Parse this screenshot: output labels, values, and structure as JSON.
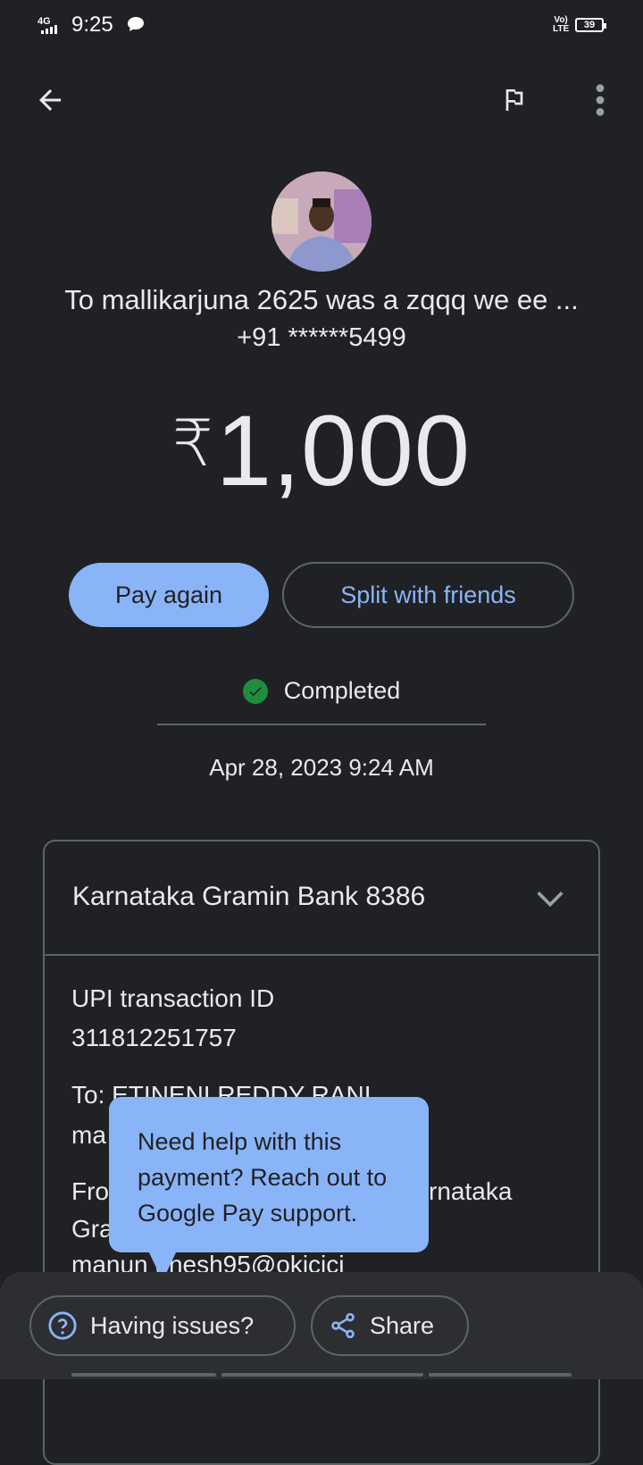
{
  "status_bar": {
    "network": "4G",
    "time": "9:25",
    "volte": "Vo)\nLTE",
    "battery": "39"
  },
  "top_bar": {
    "back_icon": "arrow-back-icon",
    "flag_icon": "flag-icon",
    "more_icon": "more-vert-icon"
  },
  "recipient": {
    "name": "To mallikarjuna 2625 was a zqqq we ee ...",
    "phone": "+91 ******5499"
  },
  "amount": {
    "currency": "₹",
    "value": "1,000"
  },
  "actions": {
    "pay_again": "Pay again",
    "split": "Split with friends"
  },
  "status": {
    "label": "Completed",
    "datetime": "Apr 28, 2023 9:24 AM",
    "color": "#1e8e3e"
  },
  "details": {
    "bank": "Karnataka Gramin Bank 8386",
    "txn_label": "UPI transaction ID",
    "txn_id": "311812251757",
    "to_line1": "To: ETINENI REDDY RANI",
    "to_line2": "ma",
    "from_line1": "Fro",
    "from_tail": "rnataka",
    "from_line2": "Gra",
    "from_line3": "manun     unesh95@okicici"
  },
  "tooltip": {
    "text": "Need help with this payment? Reach out to Google Pay support."
  },
  "bottom": {
    "issues": "Having issues?",
    "share": "Share"
  },
  "colors": {
    "background": "#202124",
    "accent": "#8ab4f8",
    "border": "#5f6368"
  }
}
